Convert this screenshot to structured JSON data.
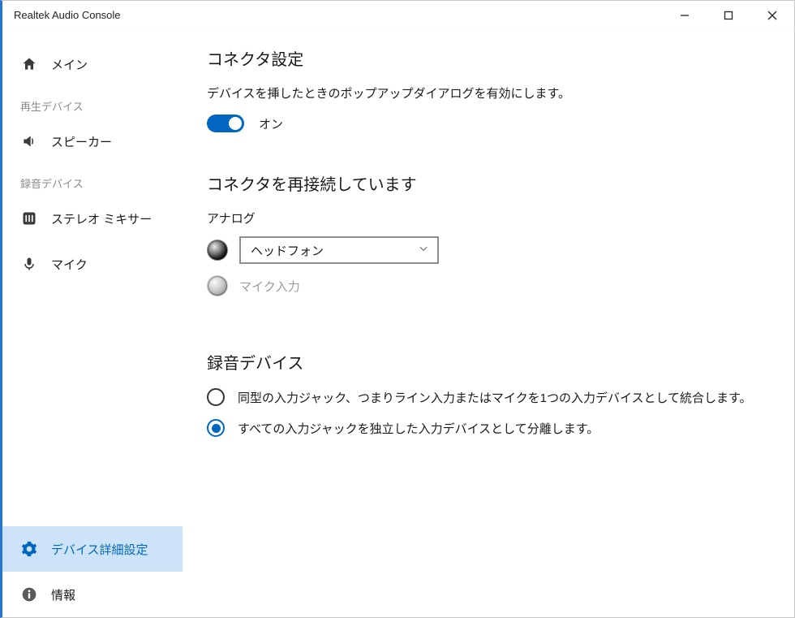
{
  "window": {
    "title": "Realtek Audio Console"
  },
  "sidebar": {
    "main": {
      "label": "メイン"
    },
    "playback_section": "再生デバイス",
    "speaker": {
      "label": "スピーカー"
    },
    "record_section": "録音デバイス",
    "stereo_mix": {
      "label": "ステレオ ミキサー"
    },
    "mic": {
      "label": "マイク"
    },
    "adv": {
      "label": "デバイス詳細設定"
    },
    "info": {
      "label": "情報"
    }
  },
  "main": {
    "connector": {
      "title": "コネクタ設定",
      "desc": "デバイスを挿したときのポップアップダイアログを有効にします。",
      "toggle_label": "オン"
    },
    "retask": {
      "title": "コネクタを再接続しています",
      "analog_label": "アナログ",
      "combo_value": "ヘッドフォン",
      "disabled_label": "マイク入力"
    },
    "recdev": {
      "title": "録音デバイス",
      "opt1": "同型の入力ジャック、つまりライン入力またはマイクを1つの入力デバイスとして統合します。",
      "opt2": "すべての入力ジャックを独立した入力デバイスとして分離します。"
    }
  }
}
